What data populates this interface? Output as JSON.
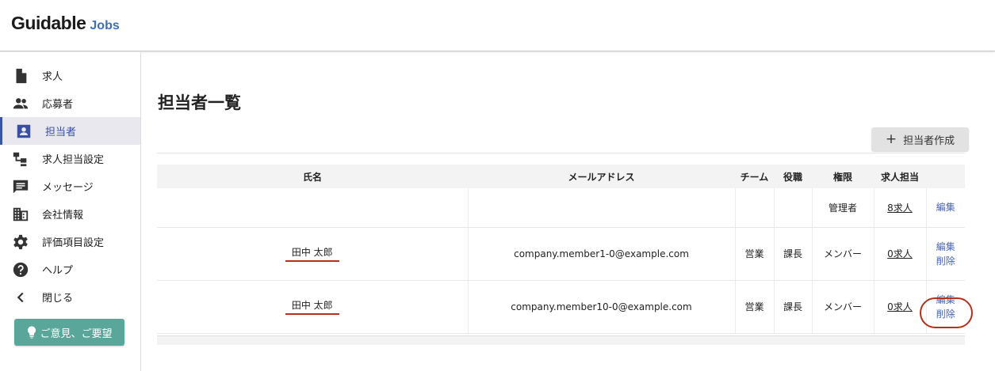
{
  "header": {
    "logo_main": "Guidable",
    "logo_sub": "Jobs"
  },
  "sidebar": {
    "items": [
      {
        "label": "求人",
        "icon": "document-icon"
      },
      {
        "label": "応募者",
        "icon": "people-icon"
      },
      {
        "label": "担当者",
        "icon": "person-badge-icon",
        "active": true
      },
      {
        "label": "求人担当設定",
        "icon": "hierarchy-icon"
      },
      {
        "label": "メッセージ",
        "icon": "message-icon"
      },
      {
        "label": "会社情報",
        "icon": "building-icon"
      },
      {
        "label": "評価項目設定",
        "icon": "gear-icon"
      },
      {
        "label": "ヘルプ",
        "icon": "help-icon"
      },
      {
        "label": "閉じる",
        "icon": "chevron-left-icon"
      }
    ],
    "feedback_label": "ご意見、ご要望"
  },
  "main": {
    "title": "担当者一覧",
    "create_button": "担当者作成",
    "table": {
      "headers": [
        "氏名",
        "メールアドレス",
        "チーム",
        "役職",
        "権限",
        "求人担当",
        ""
      ],
      "rows": [
        {
          "name": "",
          "email": "",
          "team": "",
          "role": "",
          "permission": "管理者",
          "jobs": "8求人",
          "edit": "編集",
          "delete": ""
        },
        {
          "name": "田中 太郎",
          "email": "company.member1-0@example.com",
          "team": "営業",
          "role": "課長",
          "permission": "メンバー",
          "jobs": "0求人",
          "edit": "編集",
          "delete": "削除"
        },
        {
          "name": "田中 太郎",
          "email": "company.member10-0@example.com",
          "team": "営業",
          "role": "課長",
          "permission": "メンバー",
          "jobs": "0求人",
          "edit": "編集",
          "delete": "削除"
        }
      ]
    }
  },
  "colors": {
    "accent": "#3a4fa0",
    "feedback_bg": "#5aa69a",
    "annotation": "#b5301a",
    "link": "#4a63b0"
  }
}
